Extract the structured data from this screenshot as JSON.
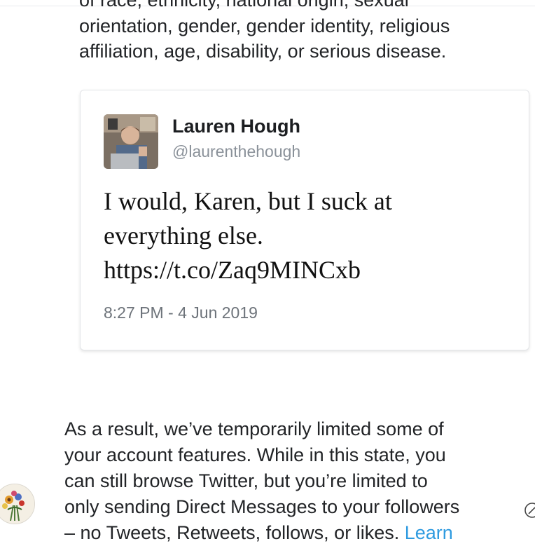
{
  "policy": {
    "line_top_clipped": "of race, ethnicity, national origin, sexual",
    "line_2": "orientation, gender, gender identity, religious",
    "line_3": "affiliation, age, disability, or serious disease."
  },
  "tweet": {
    "author_name": "Lauren Hough",
    "author_handle": "@laurenthehough",
    "text_line_1": "I would, Karen, but I suck at",
    "text_line_2": "everything else.",
    "text_line_3": "https://t.co/Zaq9MINCxb",
    "timestamp": "8:27 PM - 4 Jun 2019"
  },
  "result": {
    "line_1": "As a result, we’ve temporarily limited some of",
    "line_2": "your account features. While in this state, you",
    "line_3": "can still browse Twitter, but you’re limited to",
    "line_4": "only sending Direct Messages to your followers",
    "line_5_clipped": "– no Tweets, Retweets, follows, or likes.",
    "link_clipped": "Learn"
  },
  "icons": {
    "avatar": "profile-photo",
    "side_avatar": "flower-bouquet-avatar",
    "compose": "compose-icon"
  },
  "colors": {
    "link": "#2f9be0",
    "handle": "#8a9199",
    "text": "#222427"
  }
}
